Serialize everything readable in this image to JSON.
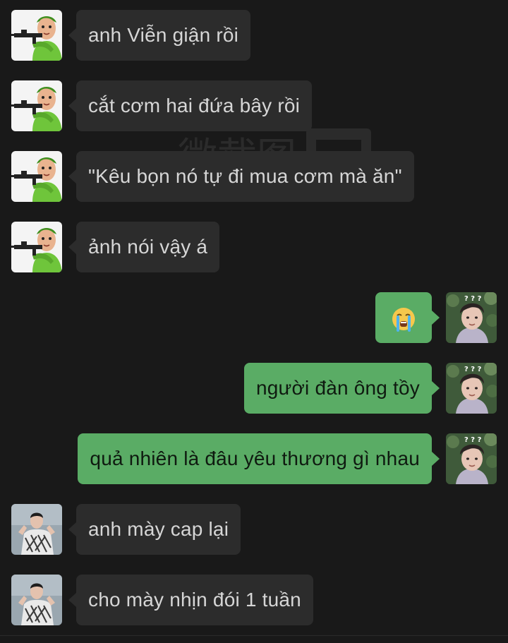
{
  "colors": {
    "background": "#191919",
    "incoming_bubble": "#2c2c2c",
    "outgoing_bubble": "#5aac65",
    "incoming_text": "#d6d6d6",
    "outgoing_text": "#0f1a10"
  },
  "watermark": {
    "label": "微截图"
  },
  "messages": [
    {
      "sender": "contact-green-costume",
      "text": "anh Viễn giận rồi"
    },
    {
      "sender": "contact-green-costume",
      "text": "cắt cơm hai đứa bây rồi"
    },
    {
      "sender": "contact-green-costume",
      "text": "\"Kêu bọn nó tự đi mua cơm mà ăn\""
    },
    {
      "sender": "contact-green-costume",
      "text": "ảnh nói vậy á"
    },
    {
      "sender": "me",
      "text": "",
      "icon": "crying-face-emoji"
    },
    {
      "sender": "me",
      "text": "người đàn ông tồy"
    },
    {
      "sender": "me",
      "text": "quả nhiên là đâu yêu thương gì nhau"
    },
    {
      "sender": "contact-striped-shirt",
      "text": "anh mày cap lại"
    },
    {
      "sender": "contact-striped-shirt",
      "text": "cho mày nhịn đói 1 tuần"
    }
  ]
}
